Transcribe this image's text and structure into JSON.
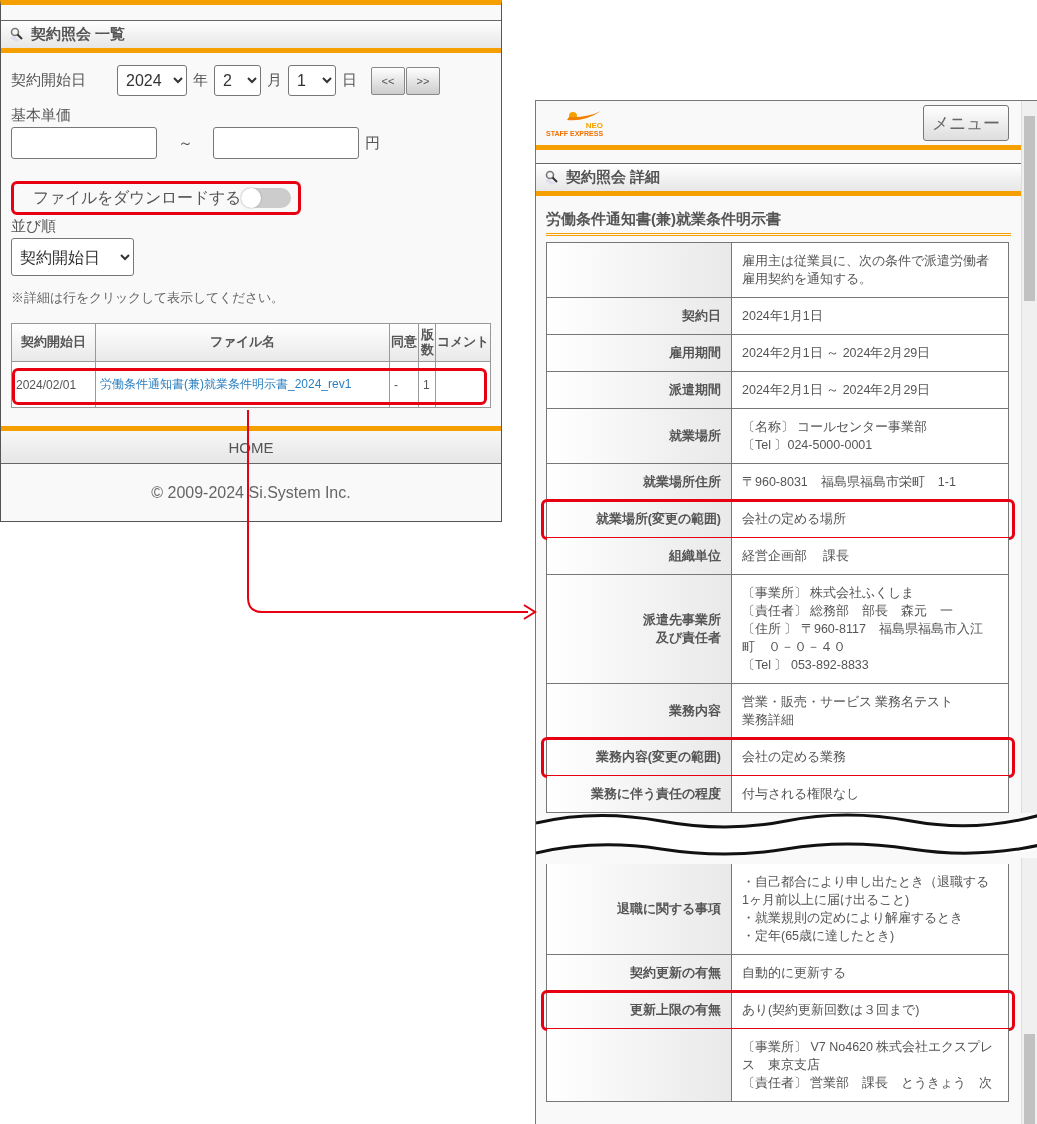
{
  "list_screen": {
    "title": "契約照会 一覧",
    "date_filter": {
      "label": "契約開始日",
      "year": "2024",
      "year_unit": "年",
      "month": "2",
      "month_unit": "月",
      "day": "1",
      "day_unit": "日",
      "prev_button": "<<",
      "next_button": ">>"
    },
    "price_filter": {
      "label": "基本単価",
      "range_separator": "～",
      "unit": "円"
    },
    "download_toggle": {
      "label": "ファイルをダウンロードする",
      "on": false,
      "highlighted": true
    },
    "sort": {
      "label": "並び順",
      "value": "契約開始日"
    },
    "note": "※詳細は行をクリックして表示してください。",
    "table": {
      "columns": [
        "契約開始日",
        "ファイル名",
        "同意",
        "版数",
        "コメント"
      ],
      "rows": [
        {
          "start_date": "2024/02/01",
          "file_name": "労働条件通知書(兼)就業条件明示書_2024_rev1",
          "agreement": "-",
          "version": "1",
          "highlighted": true
        }
      ]
    },
    "home_link": "HOME",
    "footer": "© 2009-2024 Si.System Inc."
  },
  "detail_screen": {
    "logo": {
      "mark": "NEO",
      "name": "STAFF EXPRESS"
    },
    "menu_button": "メニュー",
    "title": "契約照会 詳細",
    "document_title": "労働条件通知書(兼)就業条件明示書",
    "rows": [
      {
        "value": [
          "雇用主は従業員に、次の条件で派遣労働者雇用契約を通知する。"
        ],
        "highlighted": false
      },
      {
        "label": [
          "契約日"
        ],
        "value": [
          "2024年1月1日"
        ],
        "highlighted": false
      },
      {
        "label": [
          "雇用期間"
        ],
        "value": [
          "2024年2月1日 ～ 2024年2月29日"
        ],
        "highlighted": false
      },
      {
        "label": [
          "派遣期間"
        ],
        "value": [
          "2024年2月1日 ～ 2024年2月29日"
        ],
        "highlighted": false
      },
      {
        "label": [
          "就業場所"
        ],
        "value": [
          "〔名称〕 コールセンター事業部",
          "〔Tel 〕024-5000-0001"
        ],
        "highlighted": false
      },
      {
        "label": [
          "就業場所住所"
        ],
        "value": [
          "〒960-8031　福島県福島市栄町　1-1"
        ],
        "highlighted": false
      },
      {
        "label": [
          "就業場所(変更の範囲)"
        ],
        "value": [
          "会社の定める場所"
        ],
        "highlighted": true
      },
      {
        "label": [
          "組織単位"
        ],
        "value": [
          "経営企画部　 課長"
        ],
        "highlighted": false
      },
      {
        "label": [
          "派遣先事業所",
          "及び責任者"
        ],
        "value": [
          "〔事業所〕 株式会社ふくしま",
          "〔責任者〕 総務部　部長　森元　一",
          "〔住所 〕 〒960-8117　福島県福島市入江町　０－０－４０",
          "〔Tel 〕 053-892-8833"
        ],
        "highlighted": false
      },
      {
        "label": [
          "業務内容"
        ],
        "value": [
          "営業・販売・サービス 業務名テスト",
          "業務詳細"
        ],
        "highlighted": false
      },
      {
        "label": [
          "業務内容(変更の範囲)"
        ],
        "value": [
          "会社の定める業務"
        ],
        "highlighted": true
      },
      {
        "label": [
          "業務に伴う責任の程度"
        ],
        "value": [
          "付与される権限なし"
        ],
        "highlighted": false
      }
    ],
    "rows_after_break": [
      {
        "label": [
          "退職に関する事項"
        ],
        "value": [
          "・自己都合により申し出たとき（退職する1ヶ月前以上に届け出ること)",
          "・就業規則の定めにより解雇するとき",
          "・定年(65歳に達したとき)"
        ],
        "highlighted": false
      },
      {
        "label": [
          "契約更新の有無"
        ],
        "value": [
          "自動的に更新する"
        ],
        "highlighted": false
      },
      {
        "label": [
          "更新上限の有無"
        ],
        "value": [
          "あり(契約更新回数は３回まで)"
        ],
        "highlighted": true
      },
      {
        "value": [
          "〔事業所〕 V7 No4620 株式会社エクスプレス　東京支店",
          "〔責任者〕 営業部　課長　とうきょう　次"
        ],
        "highlighted": false
      }
    ]
  }
}
